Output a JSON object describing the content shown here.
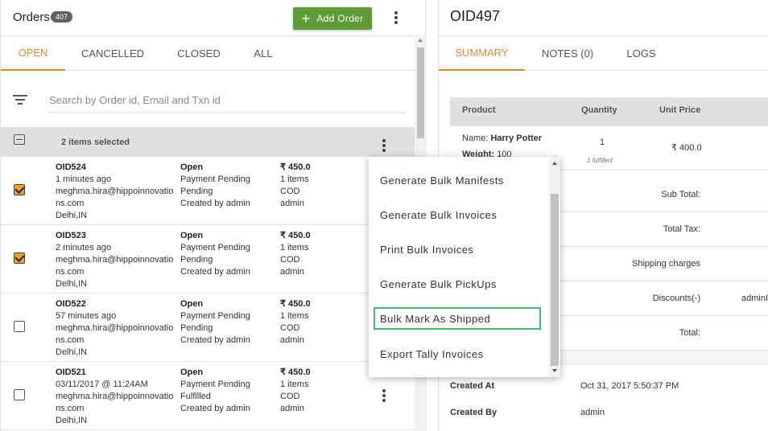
{
  "header": {
    "title": "Orders",
    "count": "407",
    "add_button": "Add Order",
    "add_icon": "+"
  },
  "tabs": [
    {
      "label": "OPEN",
      "active": true
    },
    {
      "label": "CANCELLED",
      "active": false
    },
    {
      "label": "CLOSED",
      "active": false
    },
    {
      "label": "ALL",
      "active": false
    }
  ],
  "search": {
    "placeholder": "Search by Order id, Email and Txn id",
    "value": ""
  },
  "selection": {
    "text": "2 items selected"
  },
  "orders": [
    {
      "checked": true,
      "id": "OID524",
      "time": "1 minutes ago",
      "email": "meghma.hira@hippoinnovations.com",
      "location": "Delhi,IN",
      "status": "Open",
      "payment": "Payment Pending",
      "fulfillment": "Pending",
      "created_by": "Created by admin",
      "amount": "₹ 450.0",
      "items": "1 items",
      "method": "COD",
      "user": "admin"
    },
    {
      "checked": true,
      "id": "OID523",
      "time": "2 minutes ago",
      "email": "meghma.hira@hippoinnovations.com",
      "location": "Delhi,IN",
      "status": "Open",
      "payment": "Payment Pending",
      "fulfillment": "Pending",
      "created_by": "Created by admin",
      "amount": "₹ 450.0",
      "items": "1 items",
      "method": "COD",
      "user": "admin"
    },
    {
      "checked": false,
      "id": "OID522",
      "time": "57 minutes ago",
      "email": "meghma.hira@hippoinnovations.com",
      "location": "Delhi,IN",
      "status": "Open",
      "payment": "Payment Pending",
      "fulfillment": "Pending",
      "created_by": "Created by admin",
      "amount": "₹ 450.0",
      "items": "1 items",
      "method": "COD",
      "user": "admin"
    },
    {
      "checked": false,
      "id": "OID521",
      "time": "03/11/2017 @ 11:24AM",
      "email": "meghma.hira@hippoinnovations.com",
      "location": "Delhi,IN",
      "status": "Open",
      "payment": "Payment Pending",
      "fulfillment": "Fulfilled",
      "created_by": "Created by admin",
      "amount": "₹ 450.0",
      "items": "1 items",
      "method": "COD",
      "user": "admin"
    }
  ],
  "menu": {
    "items": [
      {
        "label": "Generate Bulk Manifests",
        "focused": false
      },
      {
        "label": "Generate Bulk Invoices",
        "focused": false
      },
      {
        "label": "Print Bulk Invoices",
        "focused": false
      },
      {
        "label": "Generate Bulk PickUps",
        "focused": false
      },
      {
        "label": "Bulk Mark As Shipped",
        "focused": true
      },
      {
        "label": "Export Tally Invoices",
        "focused": false
      }
    ]
  },
  "detail": {
    "title": "OID497",
    "tabs": [
      {
        "label": "SUMMARY",
        "active": true
      },
      {
        "label": "NOTES (0)",
        "active": false
      },
      {
        "label": "LOGS",
        "active": false
      }
    ],
    "table_headers": {
      "product": "Product",
      "quantity": "Quantity",
      "unit_price": "Unit Price"
    },
    "product": {
      "name_label": "Name:",
      "name": "Harry Potter",
      "weight_label": "Weight:",
      "weight": "100",
      "quantity": "1",
      "fulfilled": "1 fulfilled",
      "unit_price": "₹ 400.0"
    },
    "summary": [
      {
        "label": "Sub Total:",
        "value": ""
      },
      {
        "label": "Total Tax:",
        "value": ""
      },
      {
        "label": "Shipping charges",
        "value": ""
      },
      {
        "label": "Discounts(-)",
        "value": "adminI"
      },
      {
        "label": "Total:",
        "value": ""
      }
    ],
    "meta": [
      {
        "key": "Created At",
        "value": "Oct 31, 2017 5:50:37 PM"
      },
      {
        "key": "Created By",
        "value": "admin"
      }
    ]
  },
  "colors": {
    "accent": "#e08a1e",
    "add_button": "#5d9c38",
    "focus_outline": "#3cbf6a",
    "checkbox_checked": "#f0a020"
  }
}
